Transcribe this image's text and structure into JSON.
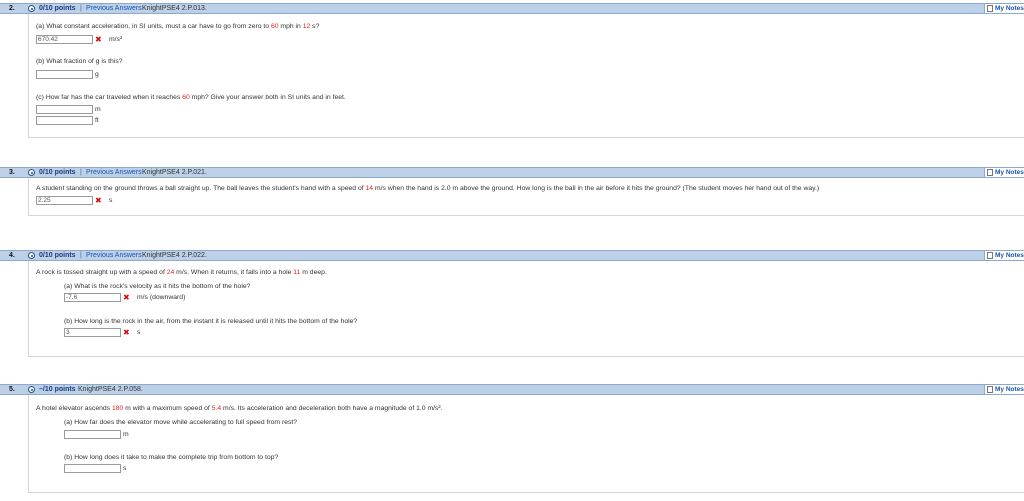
{
  "common": {
    "previous_answers": "Previous Answers",
    "separator": "|",
    "my_notes": "My Notes"
  },
  "q2": {
    "number": "2.",
    "points": "0/10 points",
    "code": "KnightPSE4 2.P.013.",
    "part_a": {
      "pre": "(a) What constant acceleration, in SI units, must a car have to go from zero to ",
      "v1": "60",
      "mid": " mph in ",
      "v2": "12",
      "post": " s?"
    },
    "part_a_answer": "670.42",
    "part_a_unit": "m/s²",
    "part_b": "(b) What fraction of g is this?",
    "part_b_answer": "",
    "part_b_unit": "g",
    "part_c": {
      "pre": "(c) How far has the car traveled when it reaches ",
      "v1": "60",
      "post": " mph? Give your answer both in SI units and in feet."
    },
    "part_c_answer_m": "",
    "part_c_unit_m": "m",
    "part_c_answer_ft": "",
    "part_c_unit_ft": "ft"
  },
  "q3": {
    "number": "3.",
    "points": "0/10 points",
    "code": "KnightPSE4 2.P.021.",
    "text": {
      "pre": "A student standing on the ground throws a ball straight up. The ball leaves the student's hand with a speed of ",
      "v1": "14",
      "post": " m/s when the hand is 2.0 m above the ground. How long is the ball in the air before it hits the ground? (The student moves her hand out of the way.)"
    },
    "answer": "2.25",
    "unit": "s"
  },
  "q4": {
    "number": "4.",
    "points": "0/10 points",
    "code": "KnightPSE4 2.P.022.",
    "text": {
      "pre": "A rock is tossed straight up with a speed of ",
      "v1": "24",
      "mid": " m/s. When it returns, it falls into a hole ",
      "v2": "11",
      "post": " m deep."
    },
    "part_a": "(a) What is the rock's velocity as it hits the bottom of the hole?",
    "part_a_answer": "-7.6",
    "part_a_unit": "m/s (downward)",
    "part_b": "(b) How long is the rock in the air, from the instant it is released until it hits the bottom of the hole?",
    "part_b_answer": "3",
    "part_b_unit": "s"
  },
  "q5": {
    "number": "5.",
    "points": "–/10 points",
    "code": "KnightPSE4 2.P.058.",
    "text": {
      "pre": "A hotel elevator ascends ",
      "v1": "180",
      "mid": " m with a maximum speed of ",
      "v2": "5.4",
      "post": " m/s. Its acceleration and deceleration both have a magnitude of 1.0 m/s²."
    },
    "part_a": "(a) How far does the elevator move while accelerating to full speed from rest?",
    "part_a_answer": "",
    "part_a_unit": "m",
    "part_b": "(b) How long does it take to make the complete trip from bottom to top?",
    "part_b_answer": "",
    "part_b_unit": "s"
  }
}
